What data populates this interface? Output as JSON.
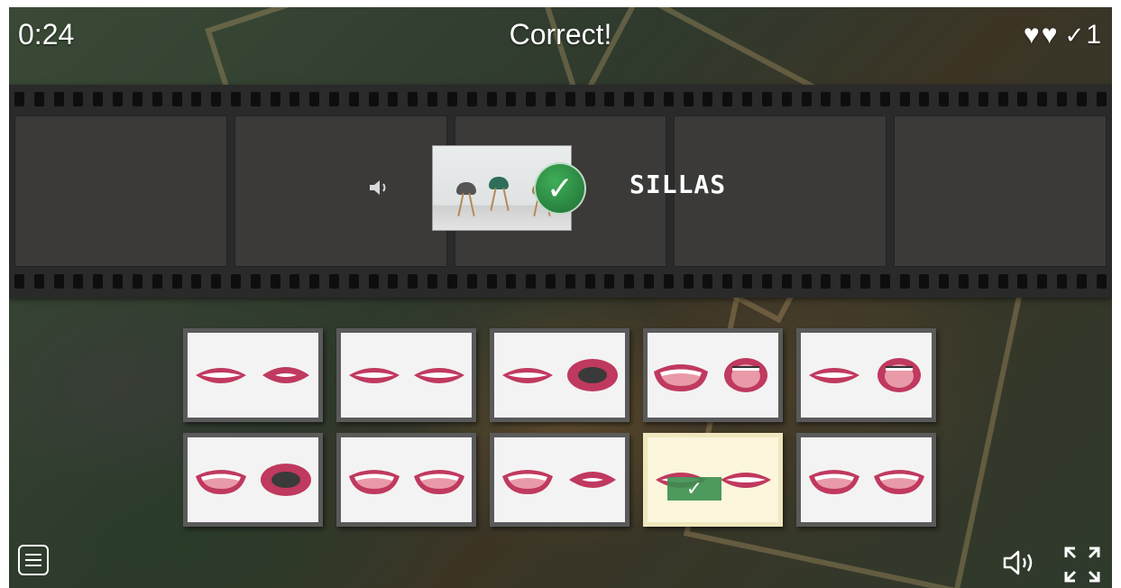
{
  "hud": {
    "timer": "0:24",
    "status": "Correct!",
    "lives": [
      "♥",
      "♥"
    ],
    "score_icon": "✓",
    "score": "1"
  },
  "question": {
    "word": "SILLAS",
    "speaker_icon": "speaker-small-icon",
    "image_icon": "chairs-photo",
    "result_icon": "check-circle-icon"
  },
  "cards": [
    {
      "name": "card-1",
      "lips": [
        "wide-smile",
        "small-open"
      ],
      "selected": false
    },
    {
      "name": "card-2",
      "lips": [
        "wide-smile",
        "wide-smile"
      ],
      "selected": false
    },
    {
      "name": "card-3",
      "lips": [
        "wide-smile",
        "open-round"
      ],
      "selected": false
    },
    {
      "name": "card-4",
      "lips": [
        "open-wide",
        "open-tall"
      ],
      "selected": false
    },
    {
      "name": "card-5",
      "lips": [
        "wide-smile",
        "open-tall"
      ],
      "selected": false
    },
    {
      "name": "card-6",
      "lips": [
        "open-smile",
        "open-round"
      ],
      "selected": false
    },
    {
      "name": "card-7",
      "lips": [
        "open-smile",
        "open-smile"
      ],
      "selected": false
    },
    {
      "name": "card-8",
      "lips": [
        "open-smile",
        "small-open"
      ],
      "selected": false
    },
    {
      "name": "card-9",
      "lips": [
        "wide-smile",
        "wide-smile"
      ],
      "selected": true,
      "check": "✓"
    },
    {
      "name": "card-10",
      "lips": [
        "open-smile",
        "open-smile"
      ],
      "selected": false
    }
  ],
  "controls": {
    "menu_icon": "menu-icon",
    "sound_icon": "sound-icon",
    "fullscreen_icon": "fullscreen-icon"
  },
  "colors": {
    "lip": "#c0395f",
    "lip_dark": "#8e2446",
    "check_green": "#2f8a45",
    "selected_card": "#fbf6dc"
  }
}
